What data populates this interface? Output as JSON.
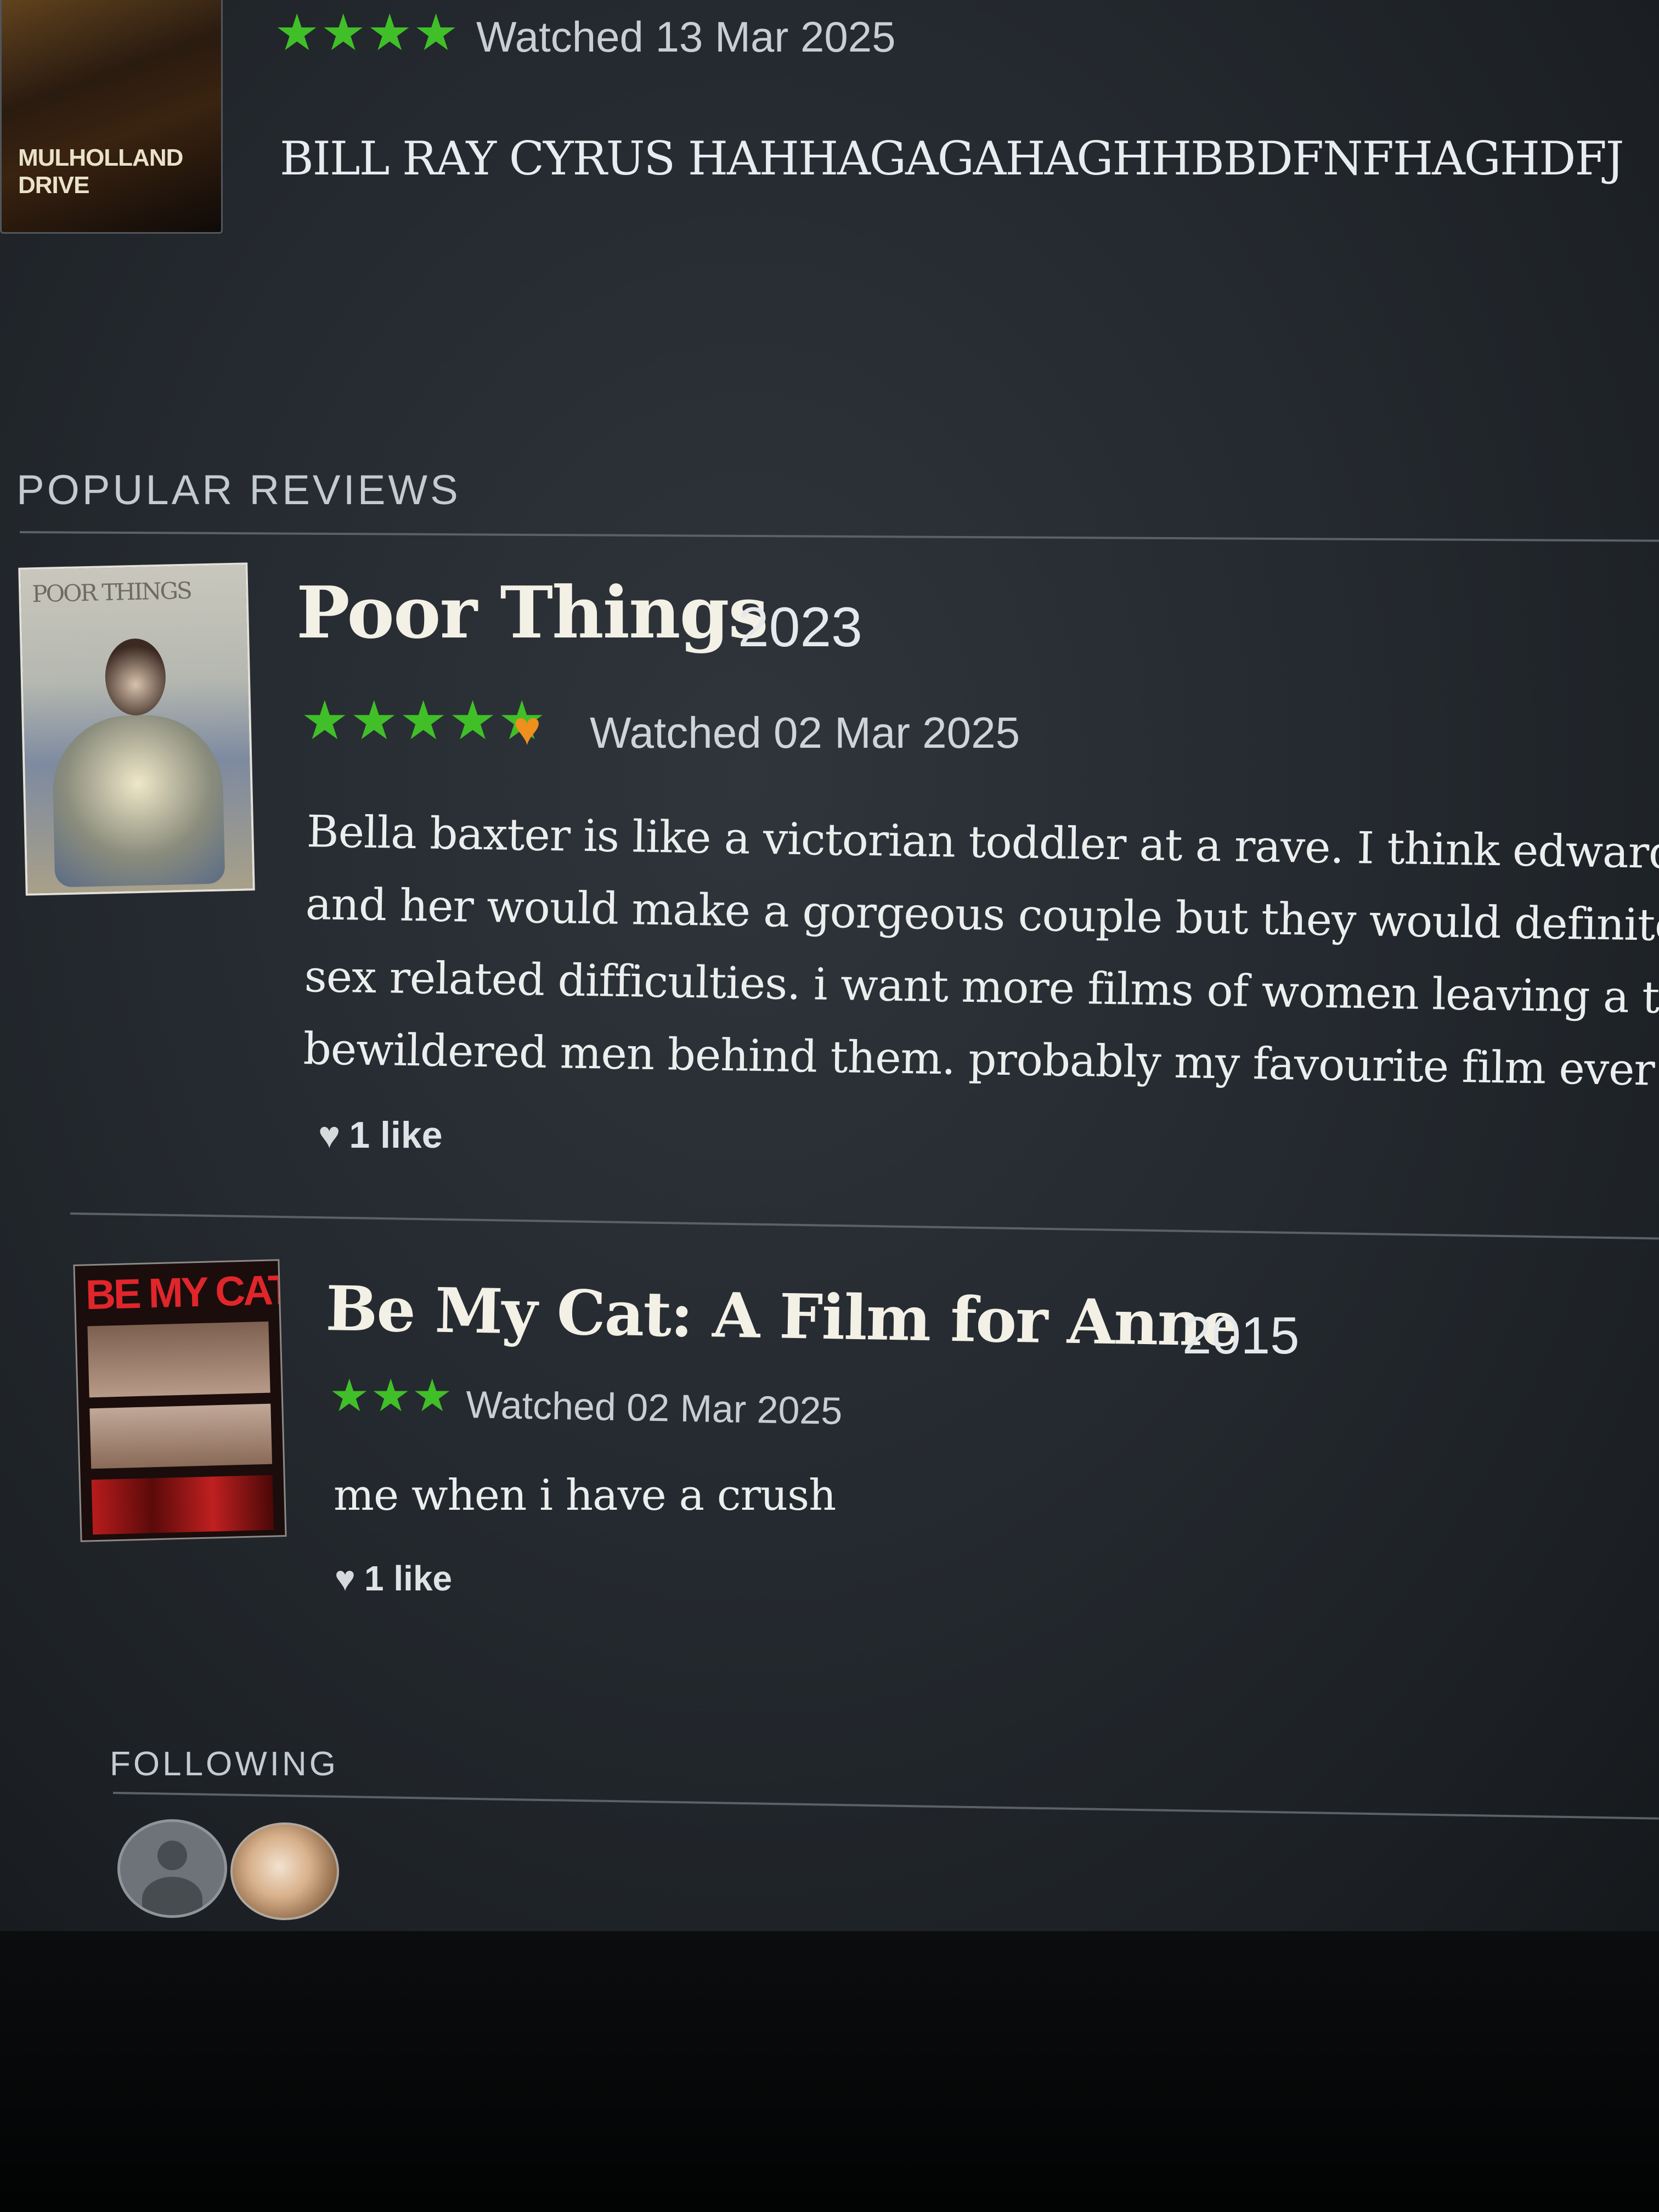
{
  "top_review": {
    "poster_title": "MULHOLLAND DRIVE",
    "stars": "★★★★",
    "watched": "Watched 13 Mar 2025",
    "text": "BILL RAY CYRUS HAHHAGAGAHAGHHBBDFNFHAGHDFJ"
  },
  "popular_reviews": {
    "header": "POPULAR REVIEWS",
    "reviews": [
      {
        "poster_title": "POOR THINGS",
        "title": "Poor Things",
        "year": "2023",
        "stars": "★★★★★",
        "liked": true,
        "heart": "♥",
        "watched": "Watched 02 Mar 2025",
        "body_lines": [
          "Bella baxter is like a victorian toddler at a rave.  I think edward s",
          "and her would make a gorgeous couple but they would definitely",
          "sex related difficulties. i want more films of women leaving a trai",
          "bewildered men behind them. probably my favourite film ever"
        ],
        "likes": "1 like"
      },
      {
        "poster_title": "BE MY CAT",
        "poster_subtitle": "A Film for Anne",
        "title": "Be My Cat: A Film for Anne",
        "year": "2015",
        "stars": "★★★",
        "watched": "Watched 02 Mar 2025",
        "body_lines": [
          "me when i have a crush"
        ],
        "likes": "1 like"
      }
    ]
  },
  "following": {
    "header": "FOLLOWING",
    "avatars": [
      "default-avatar",
      "photo-avatar"
    ]
  },
  "colors": {
    "star_green": "#40bf28",
    "heart_orange": "#ef8f1e",
    "background": "#252a30"
  }
}
